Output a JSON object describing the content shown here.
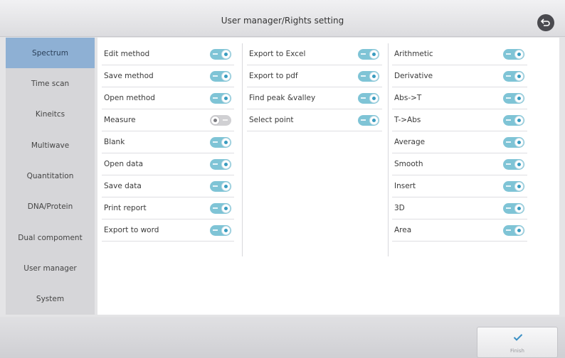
{
  "header": {
    "title": "User manager/Rights setting",
    "back_icon": "back-arrow-icon"
  },
  "sidebar": {
    "items": [
      {
        "label": "Spectrum",
        "active": true
      },
      {
        "label": "Time scan",
        "active": false
      },
      {
        "label": "Kineitcs",
        "active": false
      },
      {
        "label": "Multiwave",
        "active": false
      },
      {
        "label": "Quantitation",
        "active": false
      },
      {
        "label": "DNA/Protein",
        "active": false
      },
      {
        "label": "Dual compoment",
        "active": false
      },
      {
        "label": "User manager",
        "active": false
      },
      {
        "label": "System",
        "active": false
      }
    ]
  },
  "rights": {
    "col1": [
      {
        "label": "Edit method",
        "enabled": true
      },
      {
        "label": "Save method",
        "enabled": true
      },
      {
        "label": "Open method",
        "enabled": true
      },
      {
        "label": "Measure",
        "enabled": false
      },
      {
        "label": "Blank",
        "enabled": true
      },
      {
        "label": "Open data",
        "enabled": true
      },
      {
        "label": "Save data",
        "enabled": true
      },
      {
        "label": "Print report",
        "enabled": true
      },
      {
        "label": "Export to word",
        "enabled": true
      }
    ],
    "col2": [
      {
        "label": "Export to Excel",
        "enabled": true
      },
      {
        "label": "Export to pdf",
        "enabled": true
      },
      {
        "label": "Find peak &valley",
        "enabled": true
      },
      {
        "label": "Select point",
        "enabled": true
      }
    ],
    "col3": [
      {
        "label": "Arithmetic",
        "enabled": true
      },
      {
        "label": "Derivative",
        "enabled": true
      },
      {
        "label": "Abs->T",
        "enabled": true
      },
      {
        "label": "T->Abs",
        "enabled": true
      },
      {
        "label": "Average",
        "enabled": true
      },
      {
        "label": "Smooth",
        "enabled": true
      },
      {
        "label": "Insert",
        "enabled": true
      },
      {
        "label": "3D",
        "enabled": true
      },
      {
        "label": "Area",
        "enabled": true
      }
    ]
  },
  "footer": {
    "finish_label": "Finish",
    "finish_icon": "checkmark-icon"
  },
  "colors": {
    "accent": "#8eb0d4",
    "toggle_on": "#7fc4d6",
    "toggle_off": "#d0d0d3"
  }
}
